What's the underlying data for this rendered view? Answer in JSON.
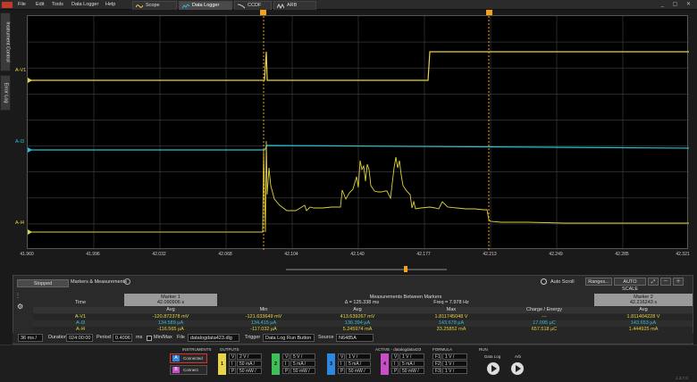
{
  "menu": {
    "items": [
      "File",
      "Edit",
      "Tools",
      "Data Logger",
      "Help"
    ]
  },
  "tabs": [
    "Scope",
    "Data Logger",
    "CCDF",
    "ARB"
  ],
  "side_tabs": [
    "Instrument Control",
    "Error Log"
  ],
  "colors": {
    "v1": "#e8d44a",
    "i3": "#2bc0d4",
    "i4": "#e0d23a",
    "marker": "#f5a21b",
    "inst_a": "#2f88e0",
    "inst_b": "#c64fc8"
  },
  "chart_data": {
    "type": "line",
    "x_ticks": [
      "41.960",
      "41.996",
      "42.032",
      "42.068",
      "42.104",
      "42.140",
      "42.177",
      "42.213",
      "42.249",
      "42.285",
      "42.321"
    ],
    "series": [
      {
        "name": "A-V1"
      },
      {
        "name": "A-I3"
      },
      {
        "name": "A-I4"
      }
    ],
    "marker1_x": 42.090906,
    "marker2_x": 42.216243,
    "grid": true
  },
  "panel": {
    "state": "Stopped",
    "title": "Markers & Measurements",
    "auto_scroll": "Auto Scroll",
    "ranges": "Ranges...",
    "auto_scale": "AUTO SCALE",
    "marker1": {
      "header": "Marker 1",
      "time": "42.090906 s",
      "sub": "Avg"
    },
    "between": {
      "header": "Measurements Between Markers",
      "delta": "Δ = 125.338 ms",
      "freq": "Freq = 7.978 Hz",
      "cols": [
        "Min",
        "Avg",
        "Max",
        "Charge / Energy"
      ]
    },
    "marker2": {
      "header": "Marker 2",
      "time": "42.216243 s",
      "sub": "Avg"
    },
    "time_label": "Time",
    "rows": [
      {
        "name": "A-V1",
        "m1": "-120.872378 mV",
        "min": "-121.633649 mV",
        "avg": "413.639267 mV",
        "max": "1.811745048 V",
        "ce": "---",
        "m2": "1.811404228 V"
      },
      {
        "name": "A-I3",
        "m1": "134.589 μA",
        "min": "134.415 μA",
        "avg": "136.394 μA",
        "max": "143.678 μA",
        "ce": "17.095 μC",
        "m2": "143.653 μA"
      },
      {
        "name": "A-I4",
        "m1": "-116.565 μA",
        "min": "-117.032 μA",
        "avg": "5.245974 mA",
        "max": "33.25852 mA",
        "ce": "657.518 μC",
        "m2": "1.444925 mA"
      }
    ]
  },
  "timebar": {
    "scale": "36 ms /",
    "duration_label": "Duration",
    "duration": "024:00:00",
    "period_label": "Period",
    "period": "0.4096",
    "period_unit": "ms",
    "minmax": "Min/Max",
    "file_label": "File",
    "file": "datalogdata423.dlg",
    "trigger_label": "Trigger",
    "trigger": "Data Log Run Button",
    "source_label": "Source",
    "source": "N6485A"
  },
  "footer": {
    "instruments": "INSTRUMENTS",
    "outputs": "OUTPUTS",
    "active": "ACTIVE - datalogdata423",
    "formula": "FORMULA",
    "run": "RUN",
    "inst_a": {
      "letter": "A",
      "status": "Connected"
    },
    "inst_b": {
      "letter": "B",
      "status": "Connect"
    },
    "ch1": {
      "num": "1",
      "v": "2 V /",
      "i": "50 mA /",
      "p": "50 mW /"
    },
    "ch2": {
      "num": "2",
      "v": "5 V /",
      "i": "5 mA /",
      "p": "50 mW /"
    },
    "ch3": {
      "num": "3",
      "v": "1 V /",
      "i": "5 mA /",
      "p": "50 mW /"
    },
    "ch4": {
      "num": "4",
      "v": "1 V /",
      "i": "5 mA /",
      "p": "50 mW /"
    },
    "f": {
      "v": "1 V /",
      "i": "1 V /",
      "p": "1 V /"
    },
    "run_data_log": "Data Log",
    "run_arb": "Arb"
  },
  "version": "1.3.7.0"
}
